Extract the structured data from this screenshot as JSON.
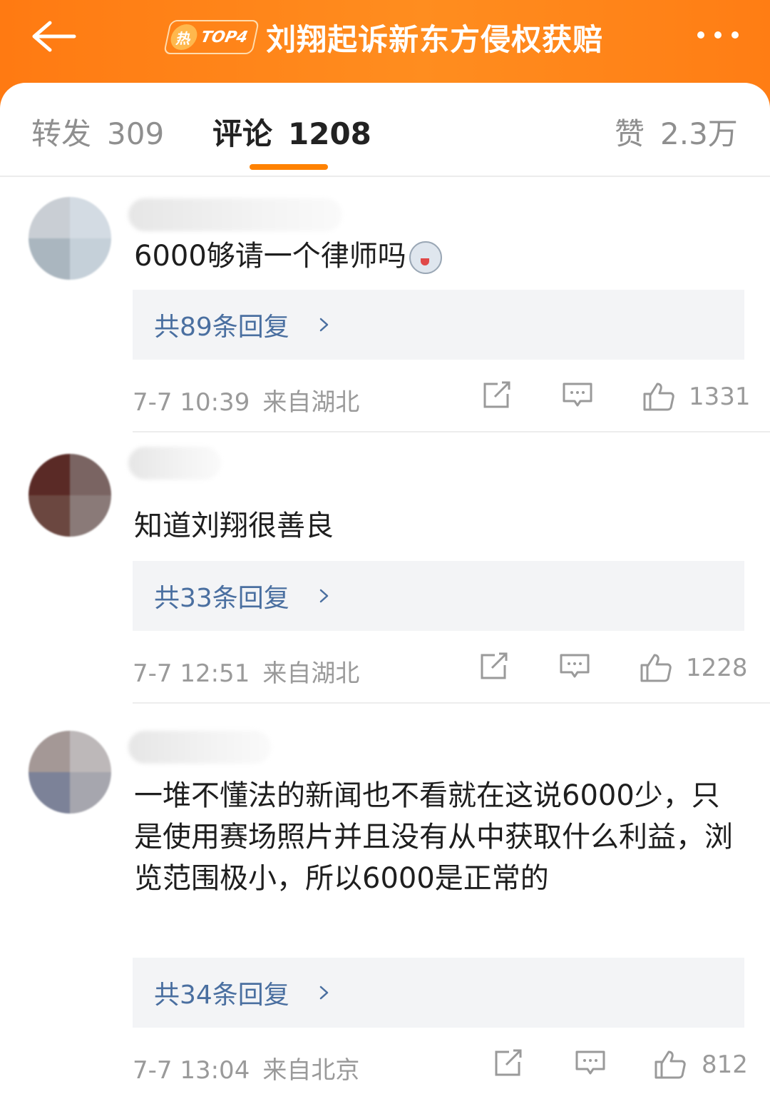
{
  "header": {
    "hot_label": "热",
    "rank_label": "TOP4",
    "title": "刘翔起诉新东方侵权获赔"
  },
  "tabs": [
    {
      "label": "转发",
      "count": "309"
    },
    {
      "label": "评论",
      "count": "1208"
    },
    {
      "label": "赞",
      "count": "2.3万"
    }
  ],
  "comments": [
    {
      "text": "6000够请一个律师吗",
      "replies_label": "共89条回复",
      "time": "7-7 10:39",
      "location": "来自湖北",
      "likes": "1331"
    },
    {
      "text": "知道刘翔很善良",
      "replies_label": "共33条回复",
      "time": "7-7 12:51",
      "location": "来自湖北",
      "likes": "1228"
    },
    {
      "text": "一堆不懂法的新闻也不看就在这说6000少，只是使用赛场照片并且没有从中获取什么利益，浏览范围极小，所以6000是正常的",
      "replies_label": "共34条回复",
      "time": "7-7 13:04",
      "location": "来自北京",
      "likes": "812"
    }
  ],
  "colors": {
    "header_orange": "#ff8200",
    "tab_underline": "#ff8200",
    "reply_link": "#4a6fa0",
    "reply_bg": "#f3f4f6"
  },
  "icons": [
    "back-arrow-icon",
    "more-dots-icon",
    "share-icon",
    "comment-icon",
    "like-icon",
    "chevron-right-icon",
    "husky-emoji-icon"
  ]
}
